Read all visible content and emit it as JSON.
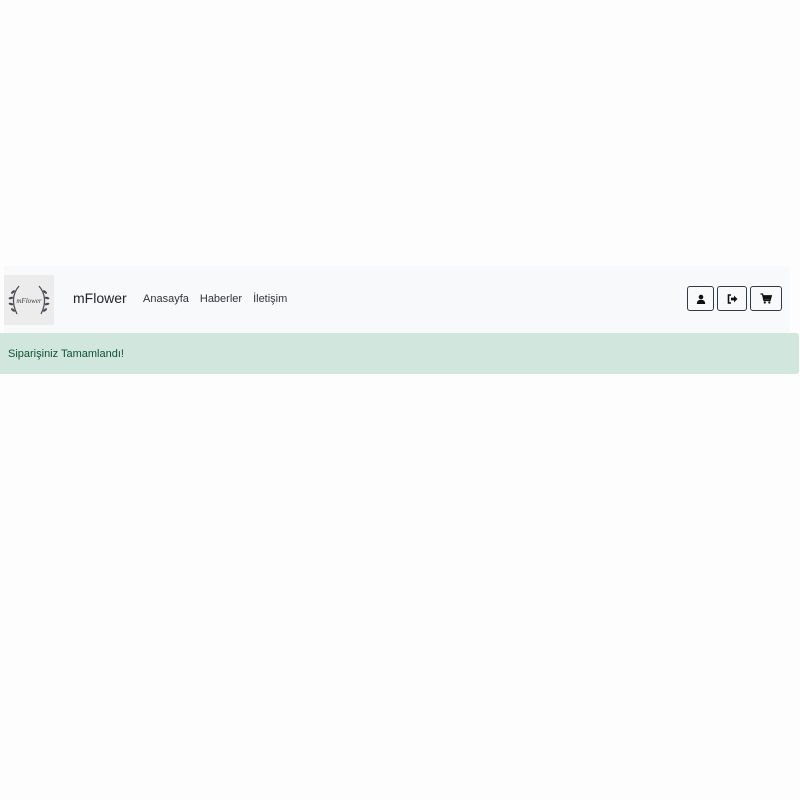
{
  "navbar": {
    "logo": {
      "icon": "wreath-logo-icon",
      "text": "mFlower"
    },
    "brand": "mFlower",
    "links": [
      {
        "label": "Anasayfa"
      },
      {
        "label": "Haberler"
      },
      {
        "label": "İletişim"
      }
    ],
    "actions": [
      {
        "icon": "user-icon"
      },
      {
        "icon": "sign-out-icon"
      },
      {
        "icon": "cart-icon"
      }
    ]
  },
  "alert": {
    "message": "Siparişiniz Tamamlandı!",
    "color": "#d1e7dd"
  }
}
